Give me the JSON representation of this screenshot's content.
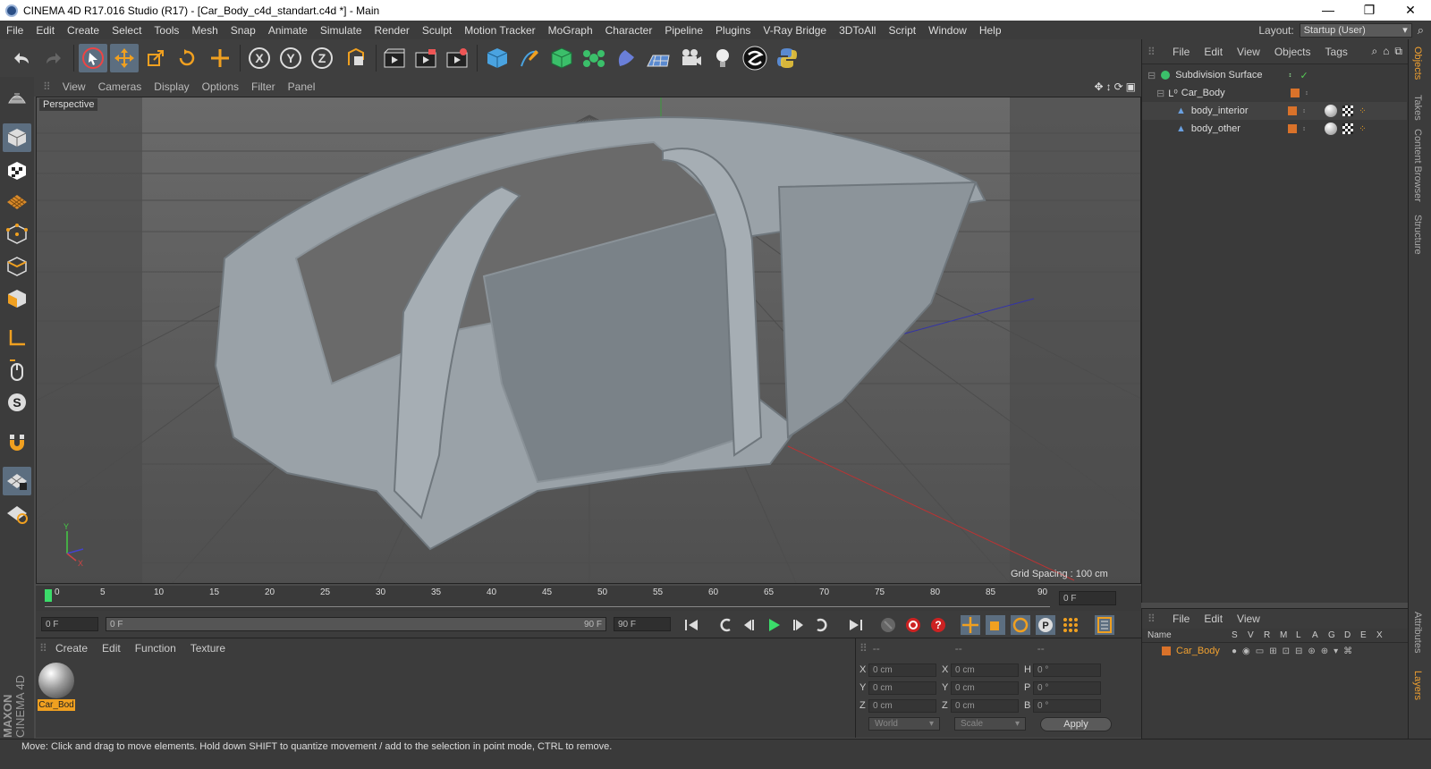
{
  "window": {
    "title": "CINEMA 4D R17.016 Studio (R17) - [Car_Body_c4d_standart.c4d *] - Main",
    "minimize": "—",
    "maximize": "❐",
    "close": "✕"
  },
  "menubar": {
    "items": [
      "File",
      "Edit",
      "Create",
      "Select",
      "Tools",
      "Mesh",
      "Snap",
      "Animate",
      "Simulate",
      "Render",
      "Sculpt",
      "Motion Tracker",
      "MoGraph",
      "Character",
      "Pipeline",
      "Plugins",
      "V-Ray Bridge",
      "3DToAll",
      "Script",
      "Window",
      "Help"
    ],
    "layout_label": "Layout:",
    "layout_value": "Startup (User)"
  },
  "viewport": {
    "menu": [
      "View",
      "Cameras",
      "Display",
      "Options",
      "Filter",
      "Panel"
    ],
    "label": "Perspective",
    "grid_spacing": "Grid Spacing : 100 cm"
  },
  "timeline": {
    "ticks": [
      "0",
      "5",
      "10",
      "15",
      "20",
      "25",
      "30",
      "35",
      "40",
      "45",
      "50",
      "55",
      "60",
      "65",
      "70",
      "75",
      "80",
      "85",
      "90"
    ],
    "current_frame": "0 F"
  },
  "playbar": {
    "start": "0 F",
    "range_start": "0 F",
    "range_end": "90 F",
    "end": "90 F"
  },
  "materials": {
    "menu": [
      "Create",
      "Edit",
      "Function",
      "Texture"
    ],
    "items": [
      {
        "name": "Car_Bod"
      }
    ]
  },
  "coords": {
    "headers": [
      "--",
      "--",
      "--"
    ],
    "rows": [
      {
        "a": "X",
        "av": "0 cm",
        "b": "X",
        "bv": "0 cm",
        "c": "H",
        "cv": "0 °"
      },
      {
        "a": "Y",
        "av": "0 cm",
        "b": "Y",
        "bv": "0 cm",
        "c": "P",
        "cv": "0 °"
      },
      {
        "a": "Z",
        "av": "0 cm",
        "b": "Z",
        "bv": "0 cm",
        "c": "B",
        "cv": "0 °"
      }
    ],
    "mode": "World",
    "size_mode": "Scale",
    "apply": "Apply"
  },
  "objects": {
    "menu": [
      "File",
      "Edit",
      "View",
      "Objects",
      "Tags"
    ],
    "items": [
      {
        "name": "Subdivision Surface"
      },
      {
        "name": "Car_Body"
      },
      {
        "name": "body_interior"
      },
      {
        "name": "body_other"
      }
    ]
  },
  "layers": {
    "menu": [
      "File",
      "Edit",
      "View"
    ],
    "columns": [
      "Name",
      "S",
      "V",
      "R",
      "M",
      "L",
      "A",
      "G",
      "D",
      "E",
      "X"
    ],
    "items": [
      {
        "name": "Car_Body"
      }
    ]
  },
  "right_tabs": [
    "Objects",
    "Takes",
    "Content Browser",
    "Structure",
    "Attributes",
    "Layers"
  ],
  "branding": {
    "maxon": "MAXON",
    "cinema": "CINEMA 4D"
  },
  "status": "Move: Click and drag to move elements. Hold down SHIFT to quantize movement / add to the selection in point mode, CTRL to remove.",
  "colors": {
    "accent": "#5c6e80",
    "layer_color": "#d9722a",
    "selected_text": "#f0a030"
  }
}
